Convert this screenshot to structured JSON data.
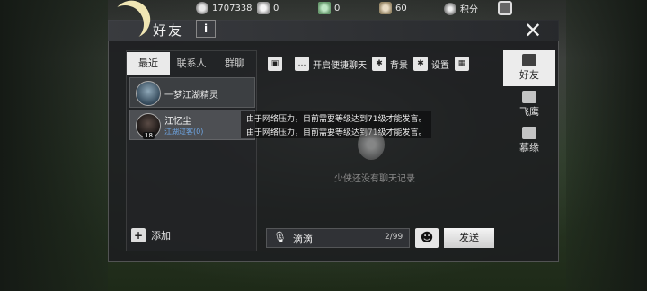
{
  "resources": {
    "coins": "1707338",
    "silver": "0",
    "jade": "0",
    "gift": "60",
    "points_label": "积分"
  },
  "window": {
    "title": "好友",
    "info_label": "i",
    "close_label": "✕"
  },
  "tabs": [
    {
      "label": "最近"
    },
    {
      "label": "联系人"
    },
    {
      "label": "群聊"
    }
  ],
  "contacts": [
    {
      "name": "一梦江湖精灵"
    },
    {
      "name": "江忆尘",
      "status": "江湖过客(0)",
      "level": "18"
    }
  ],
  "add_friend_label": "添加",
  "chat_toolbar": {
    "quick_chat_label": "开启便捷聊天",
    "background_label": "背景",
    "settings_label": "设置"
  },
  "system_messages": [
    "由于网络压力，目前需要等级达到71级才能发言。",
    "由于网络压力，目前需要等级达到71级才能发言。"
  ],
  "empty_text": "少侠还没有聊天记录",
  "input": {
    "value": "滴滴",
    "count": "2/99",
    "send_label": "发送"
  },
  "side_nav": [
    {
      "label": "好友"
    },
    {
      "label": "飞鹰"
    },
    {
      "label": "慕缘"
    }
  ]
}
